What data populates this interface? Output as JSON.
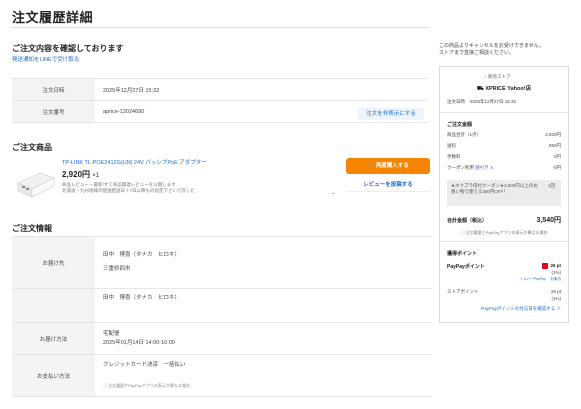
{
  "page": {
    "title": "注文履歴詳細"
  },
  "notice": {
    "title": "ご注文内容を確認しております",
    "line_link": "発送通知をLINEで受け取る"
  },
  "order": {
    "date_label": "注文日時",
    "date_value": "2025年12月27日 15:32",
    "number_label": "注文番号",
    "number_value": "aprice-12024690",
    "hide_button": "注文を非表示にする"
  },
  "product_section": {
    "title": "ご注文商品",
    "name": "TP-LINK TL-POE2412G(UN) 24V パッシブPoE アダプター",
    "price": "2,920円",
    "quantity": "×1",
    "note_line1": "商品レビュー・最新/すて商品関連レビューを公開します",
    "note_line2": "北海道・九州地域の配送配送日＋7日以降もの指定下さいで許した",
    "buy_again_button": "再度購入する",
    "review_button": "レビューを投稿する"
  },
  "info_section": {
    "title": "ご注文情報",
    "ship_label": "お届け先",
    "ship_name": "田中　博喜（タナカ　ヒロキ）",
    "ship_address": "三重県四市",
    "billing_name": "田中　博喜（タナカ　ヒロキ）",
    "delivery_label": "お届け方法",
    "delivery_method": "宅配便",
    "delivery_date": "2025年01月14日 14:00-16:00",
    "payment_label": "お支払い方法",
    "payment_method": "クレジットカード決済　一括払い",
    "payment_note": "注文履歴やPayPayアプリの表示が異なる場合"
  },
  "side": {
    "cancel_note_line1": "この商品よりキャンセルをお受けできません。",
    "cancel_note_line2": "ストアまで直接ご相談ください。",
    "store_tag": "販売ストア",
    "store_name": "XPRICE Yahoo!店",
    "order_date_label": "注文日時",
    "order_date_value": "2025年12月27日 15:32",
    "amount_title": "ご注文金額",
    "subtotal_label": "商品合計（1点）",
    "subtotal_value": "2,920円",
    "shipping_label": "送料",
    "shipping_value": "850円",
    "fee_label": "手数料",
    "fee_value": "0円",
    "coupon_label": "クーポン利用",
    "coupon_link": "値引き ∧",
    "coupon_value": "-0円",
    "coupon_desc": "★ネクプラ倍付クーポン★2,500円以上のお買い物で使える300円OFF！",
    "coupon_count": "1回",
    "total_label": "合計金額（税込）",
    "total_value": "3,540円",
    "total_note": "注文履歴とPayPayアプリの表示が異なる場合",
    "points_title": "獲得ポイント",
    "paypay_label": "PayPayポイント",
    "paypay_value": "26 pt",
    "paypay_rate": "(1%)",
    "paypay_sub": "シルバーPayPay 　対象内",
    "store_point_label": "ストアポイント",
    "store_point_value": "26 pt",
    "store_point_rate": "(1%)",
    "points_link": "PayPayポイントの付与日を確認する ＞"
  },
  "colors": {
    "accent": "#1a6dd1",
    "orange": "#f78400",
    "paypay": "#e4001b"
  }
}
